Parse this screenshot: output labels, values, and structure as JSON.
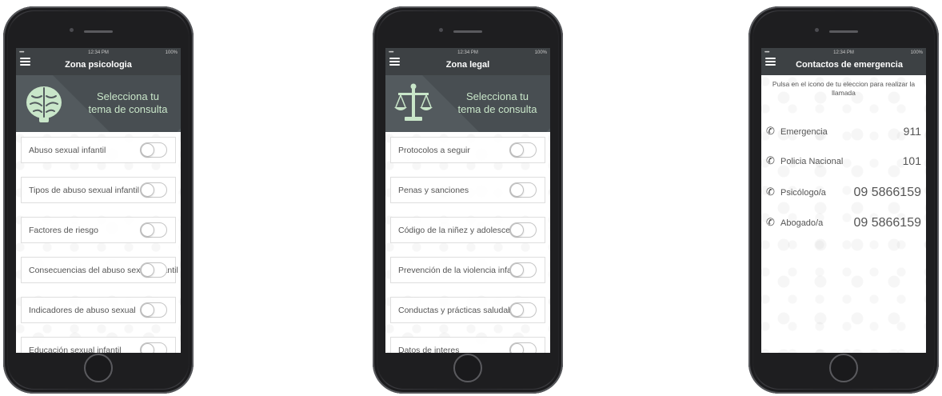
{
  "status_bar": {
    "signal": "•••••",
    "time": "12:34 PM",
    "battery": "100%"
  },
  "psychology": {
    "title": "Zona psicologia",
    "banner_line1": "Selecciona tu",
    "banner_line2": "tema de consulta",
    "banner_icon": "brain-icon",
    "items": [
      {
        "label": "Abuso sexual infantil",
        "toggle": "off"
      },
      {
        "label": "Tipos de abuso sexual infantil",
        "toggle": "off"
      },
      {
        "label": "Factores de riesgo",
        "toggle": "off"
      },
      {
        "label": "Consecuencias del abuso sexual infantil",
        "toggle": "off"
      },
      {
        "label": "Indicadores de abuso sexual",
        "toggle": "off"
      },
      {
        "label": "Educación sexual infantil",
        "toggle": "off"
      }
    ]
  },
  "legal": {
    "title": "Zona legal",
    "banner_line1": "Selecciona tu",
    "banner_line2": "tema de consulta",
    "banner_icon": "scales-icon",
    "items": [
      {
        "label": "Protocolos a seguir",
        "toggle": "off"
      },
      {
        "label": "Penas y sanciones",
        "toggle": "off"
      },
      {
        "label": "Código de la niñez y adolescencia",
        "toggle": "off"
      },
      {
        "label": "Prevención de la violencia infantil",
        "toggle": "off"
      },
      {
        "label": "Conductas y prácticas saludables",
        "toggle": "off"
      },
      {
        "label": "Datos de interes",
        "toggle": "off"
      }
    ]
  },
  "emergency": {
    "title": "Contactos de emergencia",
    "hint": "Pulsa en el icono de tu eleccion para realizar la llamada",
    "contacts": [
      {
        "name": "Emergencia",
        "number": "911"
      },
      {
        "name": "Policia Nacional",
        "number": "101"
      },
      {
        "name": "Psicólogo/a",
        "number": "09 5866159"
      },
      {
        "name": "Abogado/a",
        "number": "09 5866159"
      }
    ]
  },
  "colors": {
    "header": "#3d4144",
    "banner": "#535a5e",
    "banner_text": "#c9e6c9"
  }
}
